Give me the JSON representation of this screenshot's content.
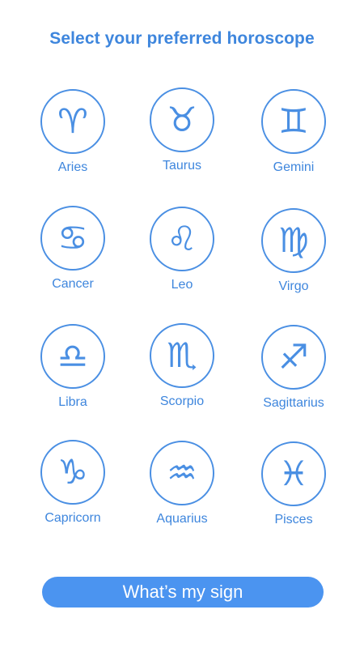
{
  "header": {
    "title": "Select your preferred horoscope"
  },
  "signs": [
    {
      "name": "Aries",
      "icon": "aries-icon",
      "glyph": "♈"
    },
    {
      "name": "Taurus",
      "icon": "taurus-icon",
      "glyph": "♉"
    },
    {
      "name": "Gemini",
      "icon": "gemini-icon",
      "glyph": "♊"
    },
    {
      "name": "Cancer",
      "icon": "cancer-icon",
      "glyph": "♋"
    },
    {
      "name": "Leo",
      "icon": "leo-icon",
      "glyph": "♌"
    },
    {
      "name": "Virgo",
      "icon": "virgo-icon",
      "glyph": "♍"
    },
    {
      "name": "Libra",
      "icon": "libra-icon",
      "glyph": "♎"
    },
    {
      "name": "Scorpio",
      "icon": "scorpio-icon",
      "glyph": "♏"
    },
    {
      "name": "Sagittarius",
      "icon": "sagittarius-icon",
      "glyph": "♐"
    },
    {
      "name": "Capricorn",
      "icon": "capricorn-icon",
      "glyph": "♑"
    },
    {
      "name": "Aquarius",
      "icon": "aquarius-icon",
      "glyph": "♒"
    },
    {
      "name": "Pisces",
      "icon": "pisces-icon",
      "glyph": "♓"
    }
  ],
  "action": {
    "label": "What’s my sign"
  },
  "colors": {
    "accent": "#3e86dd",
    "button": "#4b94f0",
    "background": "#ffffff"
  }
}
